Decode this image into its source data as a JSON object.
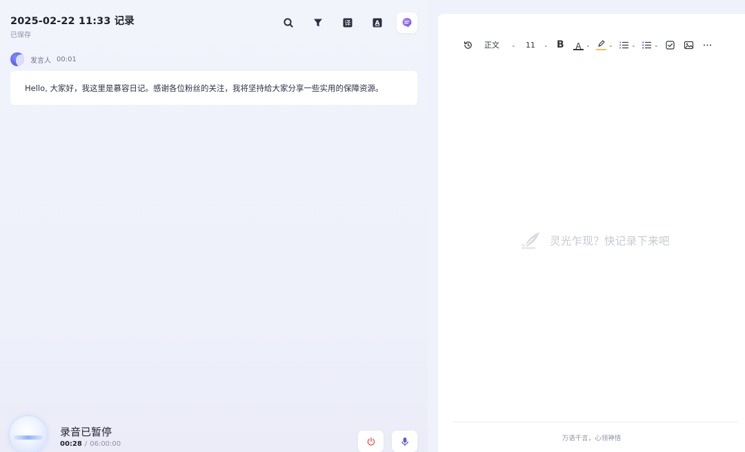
{
  "header": {
    "title": "2025-02-22 11:33 记录",
    "saved_status": "已保存"
  },
  "toolbar_icons": [
    {
      "name": "search-icon"
    },
    {
      "name": "filter-icon"
    },
    {
      "name": "translate-icon",
      "glyph": "译"
    },
    {
      "name": "text-dictionary-icon",
      "glyph": "A"
    },
    {
      "name": "ai-assistant-icon"
    }
  ],
  "transcript": {
    "speaker": "发言人",
    "time": "00:01",
    "text": "Hello, 大家好，我这里是慕容日记。感谢各位粉丝的关注，我将坚持给大家分享一些实用的保障资源。"
  },
  "recording": {
    "status": "录音已暂停",
    "elapsed": "00:28",
    "separator": "/",
    "total": "06:00:00"
  },
  "editor": {
    "paragraph_style": "正文",
    "font_size": "11",
    "bold_label": "B",
    "font_color_label": "A",
    "empty_placeholder": "灵光乍现？快记录下来吧",
    "footer": "万语千言，心领神悟"
  },
  "colors": {
    "accent": "#5b61e6",
    "stop_red": "#f06a6a",
    "mic_purple": "#5b5fd9",
    "highlight_yellow": "#f2c14e"
  }
}
